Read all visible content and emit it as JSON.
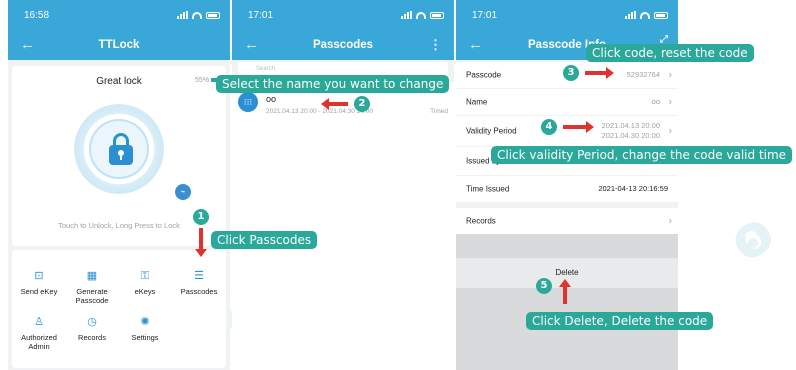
{
  "colors": {
    "primary": "#3aa7d9",
    "annotation": "#2aa89a",
    "arrow": "#e0332f",
    "icon_blue": "#2b8fd3"
  },
  "screen1": {
    "time": "16:58",
    "title": "TTLock",
    "lock_name": "Great lock",
    "battery": "55%",
    "hint": "Touch to Unlock, Long Press to Lock",
    "menu": [
      {
        "label": "Send eKey",
        "icon": "send-ekey-icon"
      },
      {
        "label": "Generate Passcode",
        "icon": "generate-passcode-icon"
      },
      {
        "label": "eKeys",
        "icon": "ekeys-icon"
      },
      {
        "label": "Passcodes",
        "icon": "passcodes-icon"
      },
      {
        "label": "Authorized Admin",
        "icon": "authorized-admin-icon"
      },
      {
        "label": "Records",
        "icon": "records-icon"
      },
      {
        "label": "Settings",
        "icon": "settings-icon"
      }
    ]
  },
  "screen2": {
    "time": "17:01",
    "title": "Passcodes",
    "search_placeholder": "Search",
    "passcode": {
      "name": "oo",
      "dates": "2021.04.13 20:00 - 2021.04.30 20:00",
      "type": "Timed"
    }
  },
  "screen3": {
    "time": "17:01",
    "title": "Passcode Info",
    "rows": {
      "passcode": {
        "label": "Passcode",
        "value": "52932764"
      },
      "name": {
        "label": "Name",
        "value": "oo"
      },
      "validity": {
        "label": "Validity Period",
        "value_start": "2021.04.13 20:00",
        "value_end": "2021.04.30 20:00"
      },
      "issued_by": {
        "label": "Issued by"
      },
      "time_issued": {
        "label": "Time Issued",
        "value": "2021-04-13 20:16:59"
      },
      "records": {
        "label": "Records"
      }
    },
    "delete_label": "Delete"
  },
  "annotations": {
    "step1": {
      "num": "1",
      "text": "Click Passcodes"
    },
    "step2": {
      "num": "2",
      "text": "Select the name you want to change"
    },
    "step3": {
      "num": "3",
      "text": "Click code, reset the code"
    },
    "step4": {
      "num": "4",
      "text": "Click validity Period, change the code valid time"
    },
    "step5": {
      "num": "5",
      "text": "Click Delete, Delete the code"
    }
  }
}
